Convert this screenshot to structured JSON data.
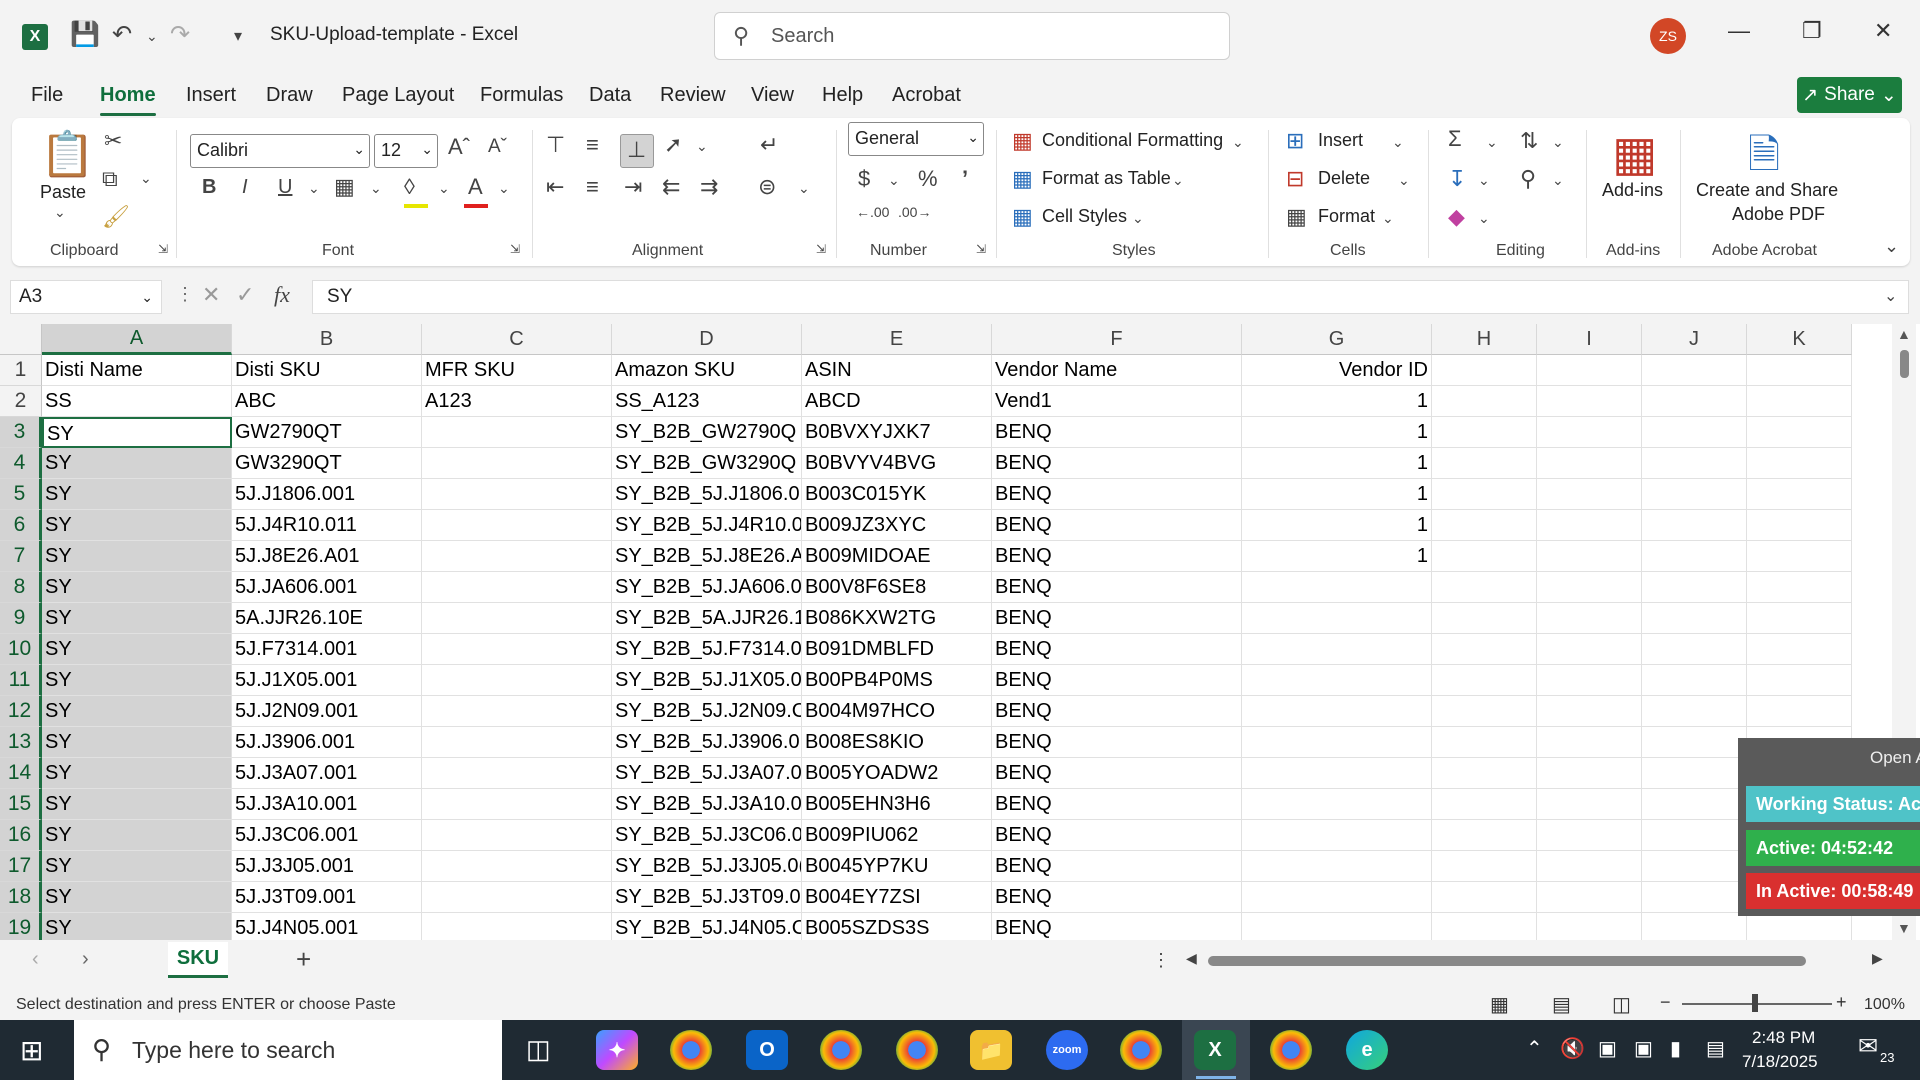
{
  "titlebar": {
    "doc_title": "SKU-Upload-template  -  Excel",
    "search_placeholder": "Search",
    "avatar_initials": "ZS"
  },
  "menu": {
    "tabs": [
      "File",
      "Home",
      "Insert",
      "Draw",
      "Page Layout",
      "Formulas",
      "Data",
      "Review",
      "View",
      "Help",
      "Acrobat"
    ],
    "share": "Share"
  },
  "ribbon": {
    "clipboard": {
      "paste": "Paste",
      "label": "Clipboard"
    },
    "font": {
      "name": "Calibri",
      "size": "12",
      "label": "Font"
    },
    "alignment": {
      "label": "Alignment"
    },
    "number": {
      "format": "General",
      "label": "Number"
    },
    "styles": {
      "conditional": "Conditional Formatting",
      "format_table": "Format as Table",
      "cell_styles": "Cell Styles",
      "label": "Styles"
    },
    "cells": {
      "insert": "Insert",
      "delete": "Delete",
      "format": "Format",
      "label": "Cells"
    },
    "editing": {
      "label": "Editing"
    },
    "addins": {
      "button": "Add-ins",
      "label": "Add-ins"
    },
    "acrobat": {
      "button_line1": "Create and Share",
      "button_line2": "Adobe PDF",
      "label": "Adobe Acrobat"
    }
  },
  "formula_bar": {
    "name_box": "A3",
    "fx": "fx",
    "content": "SY"
  },
  "columns": [
    "A",
    "B",
    "C",
    "D",
    "E",
    "F",
    "G",
    "H",
    "I",
    "J",
    "K"
  ],
  "rows": [
    {
      "n": "1",
      "cells": [
        "Disti Name",
        "Disti SKU",
        "MFR SKU",
        "Amazon SKU",
        "ASIN",
        "Vendor Name",
        "Vendor ID"
      ]
    },
    {
      "n": "2",
      "cells": [
        "SS",
        "ABC",
        "A123",
        "SS_A123",
        "ABCD",
        "Vend1",
        "1"
      ]
    },
    {
      "n": "3",
      "cells": [
        "SY",
        "GW2790QT",
        "",
        "SY_B2B_GW2790Q",
        "B0BVXYJXK7",
        "BENQ",
        "1"
      ]
    },
    {
      "n": "4",
      "cells": [
        "SY",
        "GW3290QT",
        "",
        "SY_B2B_GW3290Q",
        "B0BVYV4BVG",
        "BENQ",
        "1"
      ]
    },
    {
      "n": "5",
      "cells": [
        "SY",
        "5J.J1806.001",
        "",
        "SY_B2B_5J.J1806.0",
        "B003C015YK",
        "BENQ",
        "1"
      ]
    },
    {
      "n": "6",
      "cells": [
        "SY",
        "5J.J4R10.011",
        "",
        "SY_B2B_5J.J4R10.0",
        "B009JZ3XYC",
        "BENQ",
        "1"
      ]
    },
    {
      "n": "7",
      "cells": [
        "SY",
        "5J.J8E26.A01",
        "",
        "SY_B2B_5J.J8E26.A",
        "B009MIDOAE",
        "BENQ",
        "1"
      ]
    },
    {
      "n": "8",
      "cells": [
        "SY",
        "5J.JA606.001",
        "",
        "SY_B2B_5J.JA606.0",
        "B00V8F6SE8",
        "BENQ",
        ""
      ]
    },
    {
      "n": "9",
      "cells": [
        "SY",
        "5A.JJR26.10E",
        "",
        "SY_B2B_5A.JJR26.1",
        "B086KXW2TG",
        "BENQ",
        ""
      ]
    },
    {
      "n": "10",
      "cells": [
        "SY",
        "5J.F7314.001",
        "",
        "SY_B2B_5J.F7314.0",
        "B091DMBLFD",
        "BENQ",
        ""
      ]
    },
    {
      "n": "11",
      "cells": [
        "SY",
        "5J.J1X05.001",
        "",
        "SY_B2B_5J.J1X05.0",
        "B00PB4P0MS",
        "BENQ",
        ""
      ]
    },
    {
      "n": "12",
      "cells": [
        "SY",
        "5J.J2N09.001",
        "",
        "SY_B2B_5J.J2N09.C",
        "B004M97HCO",
        "BENQ",
        ""
      ]
    },
    {
      "n": "13",
      "cells": [
        "SY",
        "5J.J3906.001",
        "",
        "SY_B2B_5J.J3906.0",
        "B008ES8KIO",
        "BENQ",
        ""
      ]
    },
    {
      "n": "14",
      "cells": [
        "SY",
        "5J.J3A07.001",
        "",
        "SY_B2B_5J.J3A07.0",
        "B005YOADW2",
        "BENQ",
        ""
      ]
    },
    {
      "n": "15",
      "cells": [
        "SY",
        "5J.J3A10.001",
        "",
        "SY_B2B_5J.J3A10.0",
        "B005EHN3H6",
        "BENQ",
        ""
      ]
    },
    {
      "n": "16",
      "cells": [
        "SY",
        "5J.J3C06.001",
        "",
        "SY_B2B_5J.J3C06.0",
        "B009PIU062",
        "BENQ",
        ""
      ]
    },
    {
      "n": "17",
      "cells": [
        "SY",
        "5J.J3J05.001",
        "",
        "SY_B2B_5J.J3J05.0(",
        "B0045YP7KU",
        "BENQ",
        ""
      ]
    },
    {
      "n": "18",
      "cells": [
        "SY",
        "5J.J3T09.001",
        "",
        "SY_B2B_5J.J3T09.0",
        "B004EY7ZSI",
        "BENQ",
        ""
      ]
    },
    {
      "n": "19",
      "cells": [
        "SY",
        "5J.J4N05.001",
        "",
        "SY_B2B_5J.J4N05.C",
        "B005SZDS3S",
        "BENQ",
        ""
      ]
    }
  ],
  "sheet": {
    "tab": "SKU",
    "add": "+"
  },
  "status": {
    "message": "Select destination and press ENTER or choose Paste",
    "zoom": "100%",
    "zoom_minus": "−",
    "zoom_plus": "+"
  },
  "widget": {
    "open": "Open A",
    "working": "Working Status: Act",
    "active": "Active: 04:52:42",
    "inactive": "In Active: 00:58:49",
    "colors": {
      "working": "#4fc3c8",
      "active": "#2fb04c",
      "inactive": "#d9302f"
    }
  },
  "taskbar": {
    "search_placeholder": "Type here to search",
    "time": "2:48 PM",
    "date": "7/18/2025",
    "notifications": "23"
  }
}
